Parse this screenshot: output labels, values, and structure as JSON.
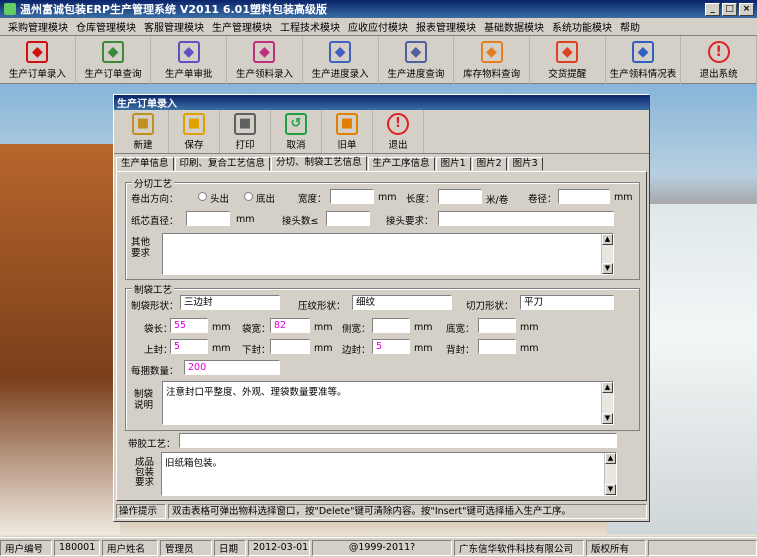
{
  "window": {
    "title": "温州富诚包装ERP生产管理系统  V2011  6.01塑料包装高级版"
  },
  "menu": [
    "采购管理模块",
    "仓库管理模块",
    "客服管理模块",
    "生产管理模块",
    "工程技术模块",
    "应收应付模块",
    "报表管理模块",
    "基础数据模块",
    "系统功能模块",
    "帮助"
  ],
  "toolbar": [
    {
      "label": "生产订单录入",
      "icon": "pdf-icon",
      "color": "#d01010"
    },
    {
      "label": "生产订单查询",
      "icon": "pdf-search-icon",
      "color": "#3a8a3a"
    },
    {
      "label": "生产单审批",
      "icon": "approve-icon",
      "color": "#6050c0"
    },
    {
      "label": "生产领料录入",
      "icon": "material-entry-icon",
      "color": "#c03080"
    },
    {
      "label": "生产进度录入",
      "icon": "progress-entry-icon",
      "color": "#4060c0"
    },
    {
      "label": "生产进度查询",
      "icon": "progress-query-icon",
      "color": "#5060a0"
    },
    {
      "label": "库存物料查询",
      "icon": "stock-icon",
      "color": "#e08020"
    },
    {
      "label": "交货提醒",
      "icon": "delivery-icon",
      "color": "#e04020"
    },
    {
      "label": "生产领料情况表",
      "icon": "report-icon",
      "color": "#3060c0"
    },
    {
      "label": "退出系统",
      "icon": "exit-icon",
      "color": "#e02020"
    }
  ],
  "child": {
    "title": "生产订单录入",
    "tools": [
      {
        "label": "新建",
        "icon": "new-doc-icon",
        "color": "#c09020"
      },
      {
        "label": "保存",
        "icon": "save-icon",
        "color": "#e0a000"
      },
      {
        "label": "打印",
        "icon": "printer-icon",
        "color": "#606060"
      },
      {
        "label": "取消",
        "icon": "cancel-icon",
        "color": "#20a040"
      },
      {
        "label": "旧单",
        "icon": "old-order-icon",
        "color": "#e08000"
      },
      {
        "label": "退出",
        "icon": "exit-icon",
        "color": "#e02020"
      }
    ],
    "tabs": [
      "生产单信息",
      "印刷、复合工艺信息",
      "分切、制袋工艺信息",
      "生产工序信息",
      "图片1",
      "图片2",
      "图片3"
    ],
    "active_tab": 2,
    "cut": {
      "group_label": "分切工艺",
      "direction_label": "卷出方向：",
      "radio1": "头出",
      "radio2": "底出",
      "width_label": "宽度：",
      "width_unit": "mm",
      "length_label": "长度：",
      "length_unit": "米/卷",
      "roll_label": "卷径：",
      "roll_unit": "mm",
      "core_label": "纸芯直径：",
      "core_unit": "mm",
      "joints_label": "接头数≤",
      "joint_req_label": "接头要求：",
      "other_label": "其他要求"
    },
    "bag": {
      "group_label": "制袋工艺",
      "shape_label": "制袋形状：",
      "shape_value": "三边封",
      "emboss_label": "压纹形状：",
      "emboss_value": "细纹",
      "cutter_label": "切刀形状：",
      "cutter_value": "平刀",
      "length_label": "袋长：",
      "length_value": "55",
      "width_label": "袋宽：",
      "width_value": "82",
      "side_label": "侧宽：",
      "bottom_label": "底宽：",
      "top_seal_label": "上封：",
      "top_seal_value": "5",
      "bottom_seal_label": "下封：",
      "edge_seal_label": "边封：",
      "edge_seal_value": "5",
      "back_seal_label": "背封：",
      "bundle_label": "每捆数量：",
      "bundle_value": "200",
      "unit": "mm",
      "note_label": "制袋说明",
      "note_value": "注意封口平整度、外观、理袋数量要准等。"
    },
    "tape_label": "带胶工艺：",
    "pack_label": "成品包装要求",
    "pack_value": "旧纸箱包装。",
    "hint_label": "操作提示",
    "hint_text": "双击表格可弹出物料选择窗口，按\"Delete\"键可清除内容。按\"Insert\"键可选择插入生产工序。"
  },
  "status": [
    {
      "label": "用户编号",
      "value": "180001"
    },
    {
      "label": "用户姓名",
      "value": "管理员"
    },
    {
      "label": "日期",
      "value": "2012-03-01"
    }
  ],
  "status_copyright": "@1999-2011?",
  "status_company": "广东信华软件科技有限公司",
  "status_rights": "版权所有"
}
